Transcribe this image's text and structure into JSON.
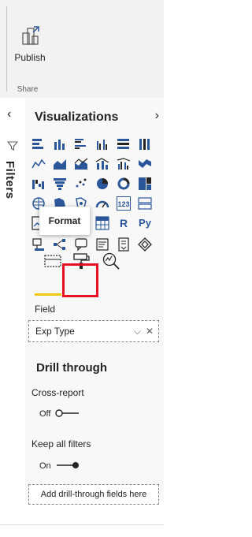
{
  "ribbon": {
    "publish_label": "Publish",
    "group_label": "Share"
  },
  "filters": {
    "label": "Filters",
    "collapse_icon": "chevron-left-icon"
  },
  "visualizations": {
    "title": "Visualizations",
    "expand_icon": "chevron-right-icon",
    "gallery": [
      [
        "stacked-bar-chart",
        "stacked-column-chart",
        "clustered-bar-chart",
        "clustered-column-chart",
        "100-stacked-bar-chart",
        "100-stacked-column-chart"
      ],
      [
        "line-chart",
        "area-chart",
        "stacked-area-chart",
        "line-and-column-chart",
        "line-and-clustered-column-chart",
        "ribbon-chart"
      ],
      [
        "waterfall-chart",
        "funnel-chart",
        "scatter-chart",
        "pie-chart",
        "donut-chart",
        "treemap"
      ],
      [
        "map",
        "filled-map",
        "shape-map",
        "gauge",
        "card",
        "multi-row-card"
      ],
      [
        "kpi",
        "slicer",
        "table",
        "matrix",
        "r-script-visual",
        "python-visual"
      ],
      [
        "key-influencers",
        "decomposition-tree",
        "qa-visual",
        "smart-narrative",
        "paginated-report",
        "power-apps"
      ]
    ],
    "glyphs": {
      "card": "123",
      "r": "R",
      "py": "Py"
    },
    "tooltip": "Format",
    "tabs": [
      "fields-tab",
      "format-tab",
      "analytics-tab"
    ]
  },
  "drillthrough": {
    "field_label": "Field",
    "field_value": "Exp Type",
    "section_title": "Drill through",
    "cross_report_label": "Cross-report",
    "cross_report_state": "Off",
    "keep_filters_label": "Keep all filters",
    "keep_filters_state": "On",
    "add_fields_text": "Add drill-through fields here"
  },
  "colors": {
    "accent_yellow": "#f2c811",
    "highlight_red": "#e81123",
    "icon_blue": "#2b579a"
  }
}
